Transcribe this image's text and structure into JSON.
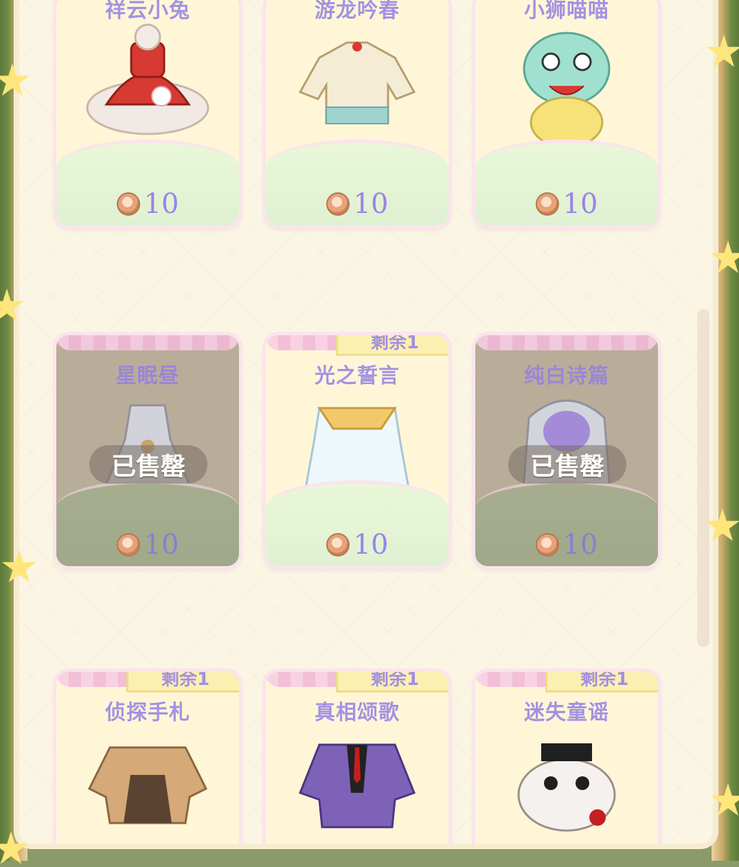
{
  "shop": {
    "items": [
      {
        "name": "祥云小兔",
        "price": "10",
        "status": "",
        "colors": [
          "#d63a32",
          "#f3ece6"
        ]
      },
      {
        "name": "游龙吟春",
        "price": "10",
        "status": "",
        "colors": [
          "#f5ecd6",
          "#9fd3cf"
        ]
      },
      {
        "name": "小狮喵喵",
        "price": "10",
        "status": "",
        "colors": [
          "#9fe0cf",
          "#f7e27a"
        ]
      },
      {
        "name": "星眠昼",
        "price": "10",
        "status": "已售罄",
        "colors": [
          "#d6d9e6",
          "#a8a4b8"
        ]
      },
      {
        "name": "光之誓言",
        "price": "10",
        "status": "剩余1",
        "colors": [
          "#eef7fb",
          "#f2c96a"
        ]
      },
      {
        "name": "纯白诗篇",
        "price": "10",
        "status": "已售罄",
        "colors": [
          "#d7dbe8",
          "#a48bd8"
        ]
      },
      {
        "name": "侦探手札",
        "price": "",
        "status": "剩余1",
        "colors": [
          "#d5a978",
          "#5b4331"
        ]
      },
      {
        "name": "真相颂歌",
        "price": "",
        "status": "剩余1",
        "colors": [
          "#7d62b8",
          "#c41f22"
        ]
      },
      {
        "name": "迷失童谣",
        "price": "",
        "status": "剩余1",
        "colors": [
          "#f5f1ee",
          "#1f1f1f"
        ]
      }
    ],
    "labels": {
      "currency_icon": "coin-icon"
    }
  }
}
